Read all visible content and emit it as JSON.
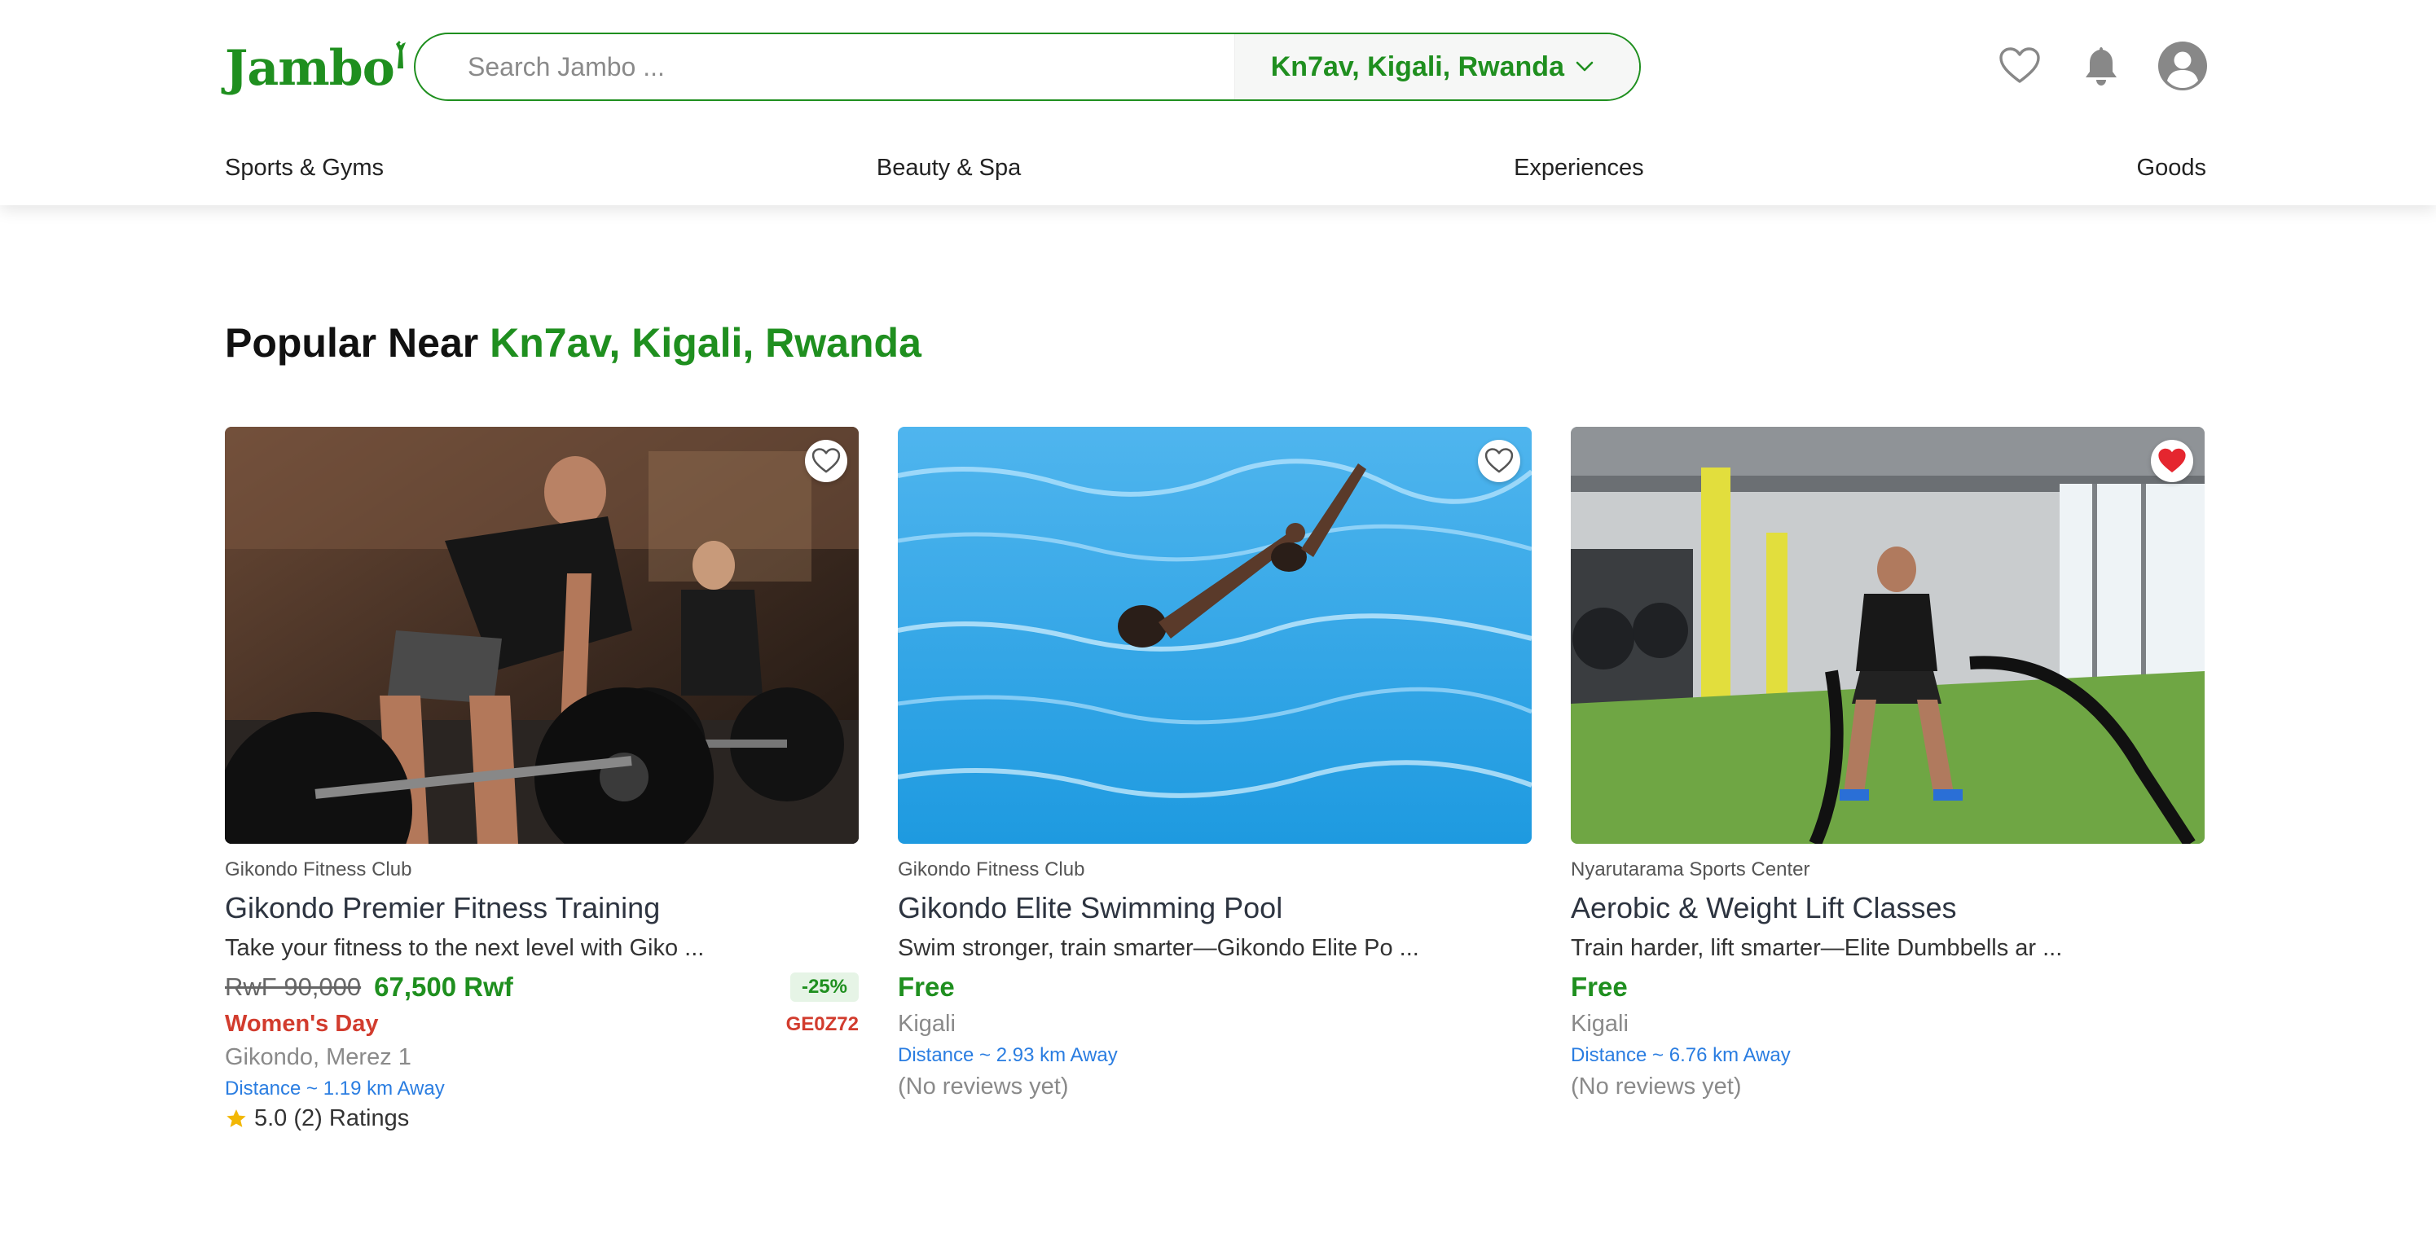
{
  "brand": {
    "logo_text": "Jambo",
    "accent_color": "#1f8f1f"
  },
  "search": {
    "placeholder": "Search Jambo ...",
    "value": ""
  },
  "location": {
    "label": "Kn7av, Kigali, Rwanda",
    "icon": "chevron-down-icon"
  },
  "header_icons": [
    "heart-icon",
    "bell-icon",
    "user-avatar-icon"
  ],
  "nav": {
    "items": [
      {
        "label": "Sports & Gyms"
      },
      {
        "label": "Beauty & Spa"
      },
      {
        "label": "Experiences"
      },
      {
        "label": "Goods"
      }
    ]
  },
  "section": {
    "prefix": "Popular Near",
    "location": "Kn7av, Kigali, Rwanda"
  },
  "cards": [
    {
      "vendor": "Gikondo Fitness Club",
      "title": "Gikondo Premier Fitness Training",
      "description": "Take your fitness to the next level with Giko ...",
      "old_price": "RwF 90,000",
      "new_price": "67,500 Rwf",
      "discount": "-25%",
      "promo_label": "Women's Day",
      "promo_code": "GE0Z72",
      "address": "Gikondo, Merez 1",
      "distance": "Distance ~ 1.19 km Away",
      "rating": "5.0 (2) Ratings",
      "favorited": false,
      "image": "weightlifting-deadlift-photo"
    },
    {
      "vendor": "Gikondo Fitness Club",
      "title": "Gikondo Elite Swimming Pool",
      "description": "Swim stronger, train smarter—Gikondo Elite Po ...",
      "price": "Free",
      "address": "Kigali",
      "distance": "Distance ~ 2.93 km Away",
      "reviews": "(No reviews yet)",
      "favorited": false,
      "image": "swimming-pool-photo"
    },
    {
      "vendor": "Nyarutarama Sports Center",
      "title": "Aerobic & Weight Lift Classes",
      "description": "Train harder, lift smarter—Elite Dumbbells ar ...",
      "price": "Free",
      "address": "Kigali",
      "distance": "Distance ~ 6.76 km Away",
      "reviews": "(No reviews yet)",
      "favorited": true,
      "image": "battle-ropes-gym-photo"
    }
  ]
}
